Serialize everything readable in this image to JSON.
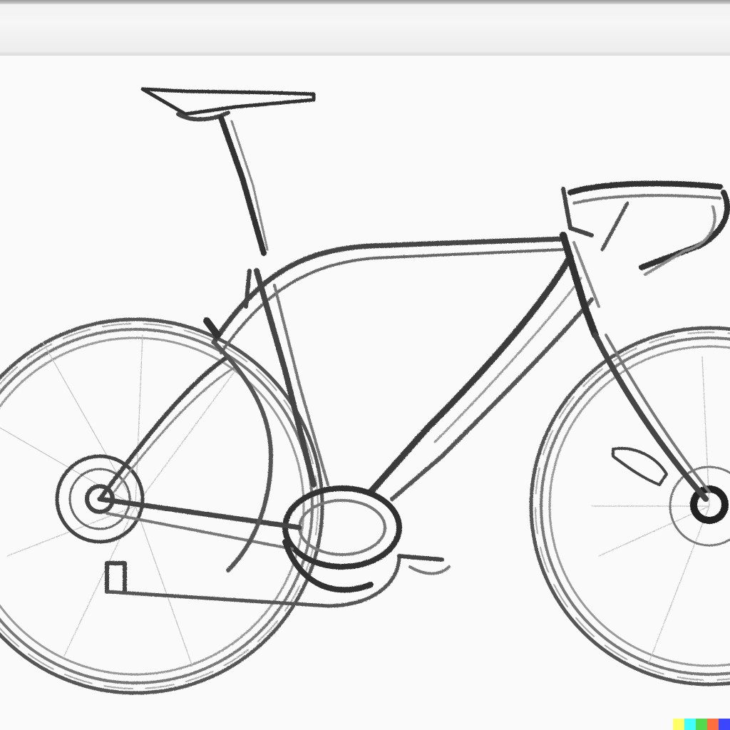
{
  "image": {
    "subject": "pencil-sketch-road-bicycle",
    "palette": {
      "paper": "#fafafa",
      "graphite_dark": "#3a3a3a",
      "graphite_mid": "#6a6a6a",
      "graphite_light": "#a8a8a8"
    }
  },
  "watermark": {
    "colors": [
      "#ffff66",
      "#42ffff",
      "#51da4c",
      "#ff6e3c",
      "#3c46ff"
    ]
  }
}
